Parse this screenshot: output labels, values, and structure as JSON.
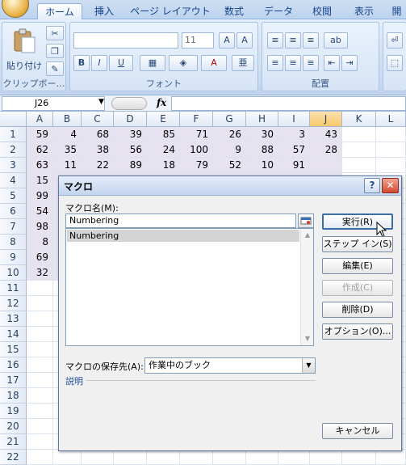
{
  "ribbon": {
    "tabs": [
      "ホーム",
      "挿入",
      "ページ レイアウト",
      "数式",
      "データ",
      "校閲",
      "表示",
      "開"
    ],
    "groups": {
      "clipboard": {
        "paste_label": "貼り付け",
        "label": "クリップボー…"
      },
      "font": {
        "size_value": "11",
        "label": "フォント"
      },
      "alignment": {
        "label": "配置"
      }
    }
  },
  "formula_bar": {
    "name_box": "J26",
    "fx": "fx"
  },
  "sheet": {
    "columns": [
      "A",
      "B",
      "C",
      "D",
      "E",
      "F",
      "G",
      "H",
      "I",
      "J",
      "K",
      "L"
    ],
    "selected_column": "J",
    "rows": [
      "1",
      "2",
      "3",
      "4",
      "5",
      "6",
      "7",
      "8",
      "9",
      "10",
      "11",
      "12",
      "13",
      "14",
      "15",
      "16",
      "17",
      "18",
      "19",
      "20",
      "21",
      "22"
    ],
    "cells": [
      [
        "59",
        "4",
        "68",
        "39",
        "85",
        "71",
        "26",
        "30",
        "3",
        "43"
      ],
      [
        "62",
        "35",
        "38",
        "56",
        "24",
        "100",
        "9",
        "88",
        "57",
        "28"
      ],
      [
        "63",
        "11",
        "22",
        "89",
        "18",
        "79",
        "52",
        "10",
        "91",
        ""
      ],
      [
        "15",
        "",
        "",
        "",
        "",
        "",
        "",
        "",
        "",
        ""
      ],
      [
        "99",
        "",
        "",
        "",
        "",
        "",
        "",
        "",
        "",
        ""
      ],
      [
        "54",
        "",
        "",
        "",
        "",
        "",
        "",
        "",
        "",
        ""
      ],
      [
        "98",
        "",
        "",
        "",
        "",
        "",
        "",
        "",
        "",
        ""
      ],
      [
        "8",
        "",
        "",
        "",
        "",
        "",
        "",
        "",
        "",
        ""
      ],
      [
        "69",
        "",
        "",
        "",
        "",
        "",
        "",
        "",
        "",
        ""
      ],
      [
        "32",
        "",
        "",
        "",
        "",
        "",
        "",
        "",
        "",
        ""
      ]
    ]
  },
  "dialog": {
    "title": "マクロ",
    "help_glyph": "?",
    "close_glyph": "✕",
    "macro_name_label": "マクロ名(M):",
    "macro_name_value": "Numbering",
    "macro_list": [
      "Numbering"
    ],
    "buttons": {
      "run": "実行(R)",
      "step_into": "ステップ イン(S)",
      "edit": "編集(E)",
      "create": "作成(C)",
      "delete": "削除(D)",
      "options": "オプション(O)...",
      "cancel": "キャンセル"
    },
    "store_in_label": "マクロの保存先(A):",
    "store_in_value": "作業中のブック",
    "description_label": "説明"
  }
}
